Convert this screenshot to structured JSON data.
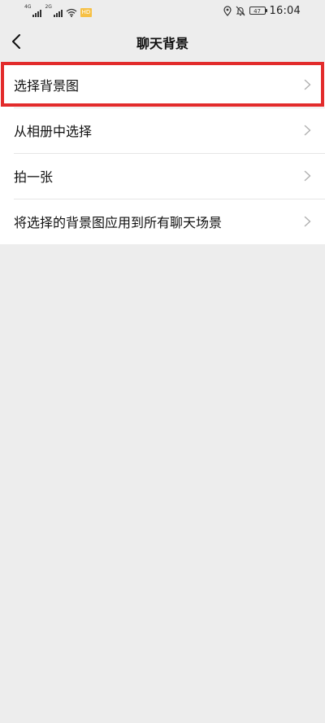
{
  "status_bar": {
    "network_1": "4G",
    "network_2": "2G",
    "sim_badge": "HD",
    "battery": "47",
    "time": "16:04"
  },
  "nav": {
    "title": "聊天背景"
  },
  "menu": {
    "items": [
      {
        "label": "选择背景图"
      },
      {
        "label": "从相册中选择"
      },
      {
        "label": "拍一张"
      },
      {
        "label": "将选择的背景图应用到所有聊天场景"
      }
    ]
  },
  "colors": {
    "page_background": "#ededed",
    "list_background": "#ffffff",
    "highlight": "#e22b2b",
    "chevron": "#b2b2b2"
  }
}
